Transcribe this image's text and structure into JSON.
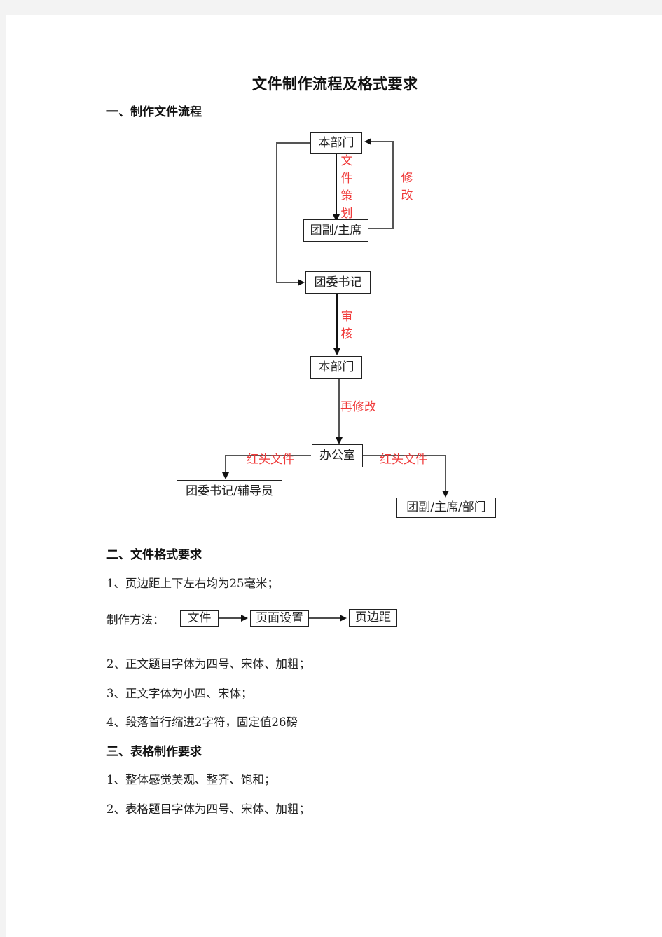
{
  "document": {
    "title": "文件制作流程及格式要求",
    "section1": {
      "heading": "一、制作文件流程",
      "flowchart": {
        "nodes": {
          "dept_top": "本部门",
          "vice_chair": "团副/主席",
          "secretary": "团委书记",
          "dept_mid": "本部门",
          "office": "办公室",
          "secretary_counselor": "团委书记/辅导员",
          "vice_chair_dept": "团副/主席/部门"
        },
        "edge_labels": {
          "planning": "文件策划",
          "revise": "修改",
          "review": "审核",
          "re_revise": "再修改",
          "red_doc_left": "红头文件",
          "red_doc_right": "红头文件"
        },
        "label_color": "#f03a3a"
      }
    },
    "section2": {
      "heading": "二、文件格式要求",
      "item1": "1、页边距上下左右均为25毫米；",
      "method": {
        "label": "制作方法：",
        "steps": [
          "文件",
          "页面设置",
          "页边距"
        ]
      },
      "item2": "2、正文题目字体为四号、宋体、加粗；",
      "item3": "3、正文字体为小四、宋体；",
      "item4": "4、段落首行缩进2字符，固定值26磅"
    },
    "section3": {
      "heading": "三、表格制作要求",
      "item1": "1、整体感觉美观、整齐、饱和；",
      "item2": "2、表格题目字体为四号、宋体、加粗；"
    }
  }
}
